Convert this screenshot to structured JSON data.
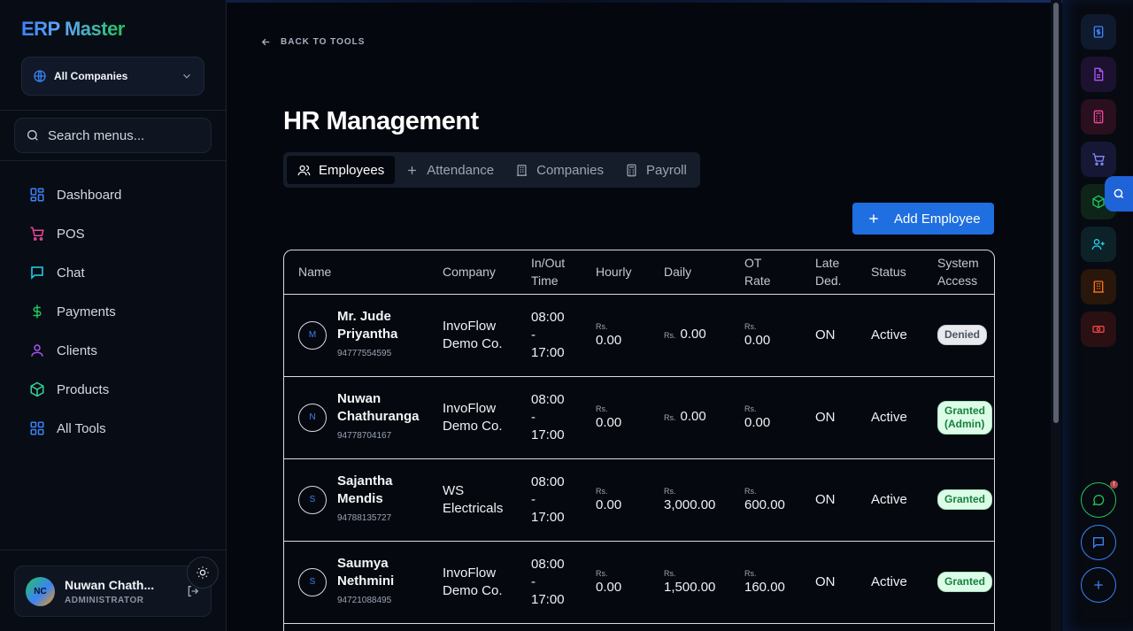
{
  "app": {
    "brand": "ERP Master"
  },
  "company_selector": {
    "value": "All Companies"
  },
  "search": {
    "placeholder": "Search menus..."
  },
  "sidebar": {
    "items": [
      {
        "label": "Dashboard",
        "icon": "dashboard-icon",
        "color": "#3b82f6"
      },
      {
        "label": "POS",
        "icon": "cart-icon",
        "color": "#ec4899"
      },
      {
        "label": "Chat",
        "icon": "chat-icon",
        "color": "#22d3ee"
      },
      {
        "label": "Payments",
        "icon": "dollar-icon",
        "color": "#22c55e"
      },
      {
        "label": "Clients",
        "icon": "user-icon",
        "color": "#a855f7"
      },
      {
        "label": "Products",
        "icon": "box-icon",
        "color": "#34d399"
      },
      {
        "label": "All Tools",
        "icon": "grid-icon",
        "color": "#3b82f6"
      }
    ]
  },
  "user": {
    "initials": "NC",
    "name": "Nuwan Chath...",
    "role": "ADMINISTRATOR"
  },
  "main": {
    "back_label": "BACK TO TOOLS",
    "title": "HR Management",
    "tabs": [
      {
        "label": "Employees",
        "icon": "users-icon",
        "active": true
      },
      {
        "label": "Attendance",
        "icon": "plus-icon",
        "active": false
      },
      {
        "label": "Companies",
        "icon": "building-icon",
        "active": false
      },
      {
        "label": "Payroll",
        "icon": "calculator-icon",
        "active": false
      }
    ],
    "add_button": "Add Employee"
  },
  "table": {
    "headers": [
      "Name",
      "Company",
      "In/Out Time",
      "Hourly",
      "Daily",
      "OT Rate",
      "Late Ded.",
      "Status",
      "System Access"
    ],
    "header_lines": [
      [
        "Name"
      ],
      [
        "Company"
      ],
      [
        "In/Out",
        "Time"
      ],
      [
        "Hourly"
      ],
      [
        "Daily"
      ],
      [
        "OT",
        "Rate"
      ],
      [
        "Late",
        "Ded."
      ],
      [
        "Status"
      ],
      [
        "System",
        "Access"
      ]
    ],
    "currency": "Rs.",
    "rows": [
      {
        "initial": "M",
        "name": "Mr. Jude Priyantha",
        "name_lines": [
          "Mr. Jude",
          "Priyantha"
        ],
        "phone": "94777554595",
        "company_lines": [
          "InvoFlow",
          "Demo Co."
        ],
        "in_time": "08:00",
        "sep": "-",
        "out_time": "17:00",
        "hourly": "0.00",
        "daily": "0.00",
        "ot_rate": "0.00",
        "late_ded": "ON",
        "status": "Active",
        "access_lines": [
          "Denied"
        ],
        "access_type": "denied"
      },
      {
        "initial": "N",
        "name": "Nuwan Chathuranga",
        "name_lines": [
          "Nuwan",
          "Chathuranga"
        ],
        "phone": "94778704167",
        "company_lines": [
          "InvoFlow",
          "Demo Co."
        ],
        "in_time": "08:00",
        "sep": "-",
        "out_time": "17:00",
        "hourly": "0.00",
        "daily": "0.00",
        "ot_rate": "0.00",
        "late_ded": "ON",
        "status": "Active",
        "access_lines": [
          "Granted",
          "(Admin)"
        ],
        "access_type": "granted"
      },
      {
        "initial": "S",
        "name": "Sajantha Mendis",
        "name_lines": [
          "Sajantha",
          "Mendis"
        ],
        "phone": "94788135727",
        "company_lines": [
          "WS",
          "Electricals"
        ],
        "in_time": "08:00",
        "sep": "-",
        "out_time": "17:00",
        "hourly": "0.00",
        "daily": "3,000.00",
        "ot_rate": "600.00",
        "late_ded": "ON",
        "status": "Active",
        "access_lines": [
          "Granted"
        ],
        "access_type": "granted"
      },
      {
        "initial": "S",
        "name": "Saumya Nethmini",
        "name_lines": [
          "Saumya",
          "Nethmini"
        ],
        "phone": "94721088495",
        "company_lines": [
          "InvoFlow",
          "Demo Co."
        ],
        "in_time": "08:00",
        "sep": "-",
        "out_time": "17:00",
        "hourly": "0.00",
        "daily": "1,500.00",
        "ot_rate": "160.00",
        "late_ded": "ON",
        "status": "Active",
        "access_lines": [
          "Granted"
        ],
        "access_type": "granted"
      }
    ]
  },
  "rail": {
    "buttons": [
      {
        "icon": "dollar-doc-icon",
        "color": "#3b82f6"
      },
      {
        "icon": "document-icon",
        "color": "#a855f7"
      },
      {
        "icon": "calculator-icon",
        "color": "#ec4899"
      },
      {
        "icon": "cart-icon",
        "color": "#818cf8"
      },
      {
        "icon": "box-icon",
        "color": "#22c55e"
      },
      {
        "icon": "user-plus-icon",
        "color": "#22d3ee"
      },
      {
        "icon": "building-icon",
        "color": "#f97316"
      },
      {
        "icon": "cash-icon",
        "color": "#ef4444"
      }
    ],
    "bottom": [
      {
        "icon": "whatsapp-icon",
        "color": "#22c55e"
      },
      {
        "icon": "message-icon",
        "color": "#3b82f6"
      },
      {
        "icon": "plus-icon",
        "color": "#3b82f6"
      }
    ],
    "notification_badge": "!"
  }
}
